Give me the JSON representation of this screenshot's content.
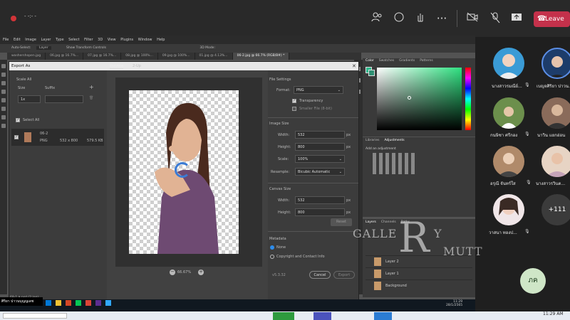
{
  "teams": {
    "meeting_timer": "- -:- -",
    "leave_label": "Leave",
    "icons": [
      "people-icon",
      "chat-icon",
      "raise-hand-icon",
      "more-icon",
      "camera-off-icon",
      "mic-off-icon",
      "share-icon",
      "phone-icon"
    ]
  },
  "photoshop": {
    "menu": [
      "File",
      "Edit",
      "Image",
      "Layer",
      "Type",
      "Select",
      "Filter",
      "3D",
      "View",
      "Plugins",
      "Window",
      "Help"
    ],
    "options": {
      "auto_select": "Auto-Select:",
      "layer": "Layer",
      "show_transform": "Show Transform Controls",
      "mode_3d": "3D Mode:"
    },
    "tabs": [
      "washershopen.jpg",
      "06.jpg @ 16.7%...",
      "07.jpg @ 16.7%...",
      "08.jpg @ 100%...",
      "09.jpg @ 100%...",
      "01.jpg @ 4.13%...",
      "06-2.jpg @ 66.7% (RGB/8#) *"
    ],
    "active_tab": 6,
    "status_file": "69-1 ล.psd (2.jpg)",
    "color_tabs": [
      "Color",
      "Swatches",
      "Gradients",
      "Patterns"
    ],
    "adj_tabs": [
      "Libraries",
      "Adjustments"
    ],
    "adj_title": "Add an adjustment",
    "layers_tabs": [
      "Layers",
      "Channels",
      "Paths"
    ],
    "layers": [
      {
        "name": "Layer 2"
      },
      {
        "name": "Layer 1"
      },
      {
        "name": "Background"
      }
    ]
  },
  "dialog": {
    "title": "Export As",
    "scale_all": "Scale All",
    "size_label": "Size",
    "suffix_label": "Suffix",
    "size_value": "1x",
    "select_all": "Select All",
    "asset": {
      "name": "06-2",
      "format": "PNG",
      "dims": "532 x 800",
      "filesize": "579.5 KB"
    },
    "preview_tab": "Preview",
    "twoup_tab": "2-Up",
    "zoom": "66.67%",
    "file_settings": "File Settings",
    "format_label": "Format:",
    "format_value": "PNG",
    "transparency": "Transparency",
    "smaller_file": "Smaller File (8-bit)",
    "image_size": "Image Size",
    "width_label": "Width:",
    "width_value": "532",
    "height_label": "Height:",
    "height_value": "800",
    "scale_label": "Scale:",
    "scale_value": "100%",
    "resample_label": "Resample:",
    "resample_value": "Bicubic Automatic",
    "px": "px",
    "canvas_size": "Canvas Size",
    "canvas_width": "532",
    "canvas_height": "800",
    "reset": "Reset",
    "metadata": "Metadata",
    "meta_none": "None",
    "meta_copyright": "Copyright and Contact Info",
    "version": "v5.3.32",
    "cancel": "Cancel",
    "export": "Export"
  },
  "participants": [
    {
      "name": "นางสาวรมณีย์...",
      "color": "#3a9bd6"
    },
    {
      "name": "เบญจศิริยา ปาวน...",
      "color": "#1d3c6a"
    },
    {
      "name": "กนษิชา ศรีกอง",
      "color": "#6c8f4c"
    },
    {
      "name": "นาวิน แยกอ่อน",
      "color": "#8a6b5a"
    },
    {
      "name": "อรุณี จันทร์ใส",
      "color": "#b08a6a"
    },
    {
      "name": "นางสาวรวินต...",
      "color": "#e7d4c4"
    },
    {
      "name": "วาสนา ทองป...",
      "color": "#f0e6e8"
    }
  ],
  "more_count": "+111",
  "my_initials": "ภค",
  "watermark": {
    "main": "GALLE",
    "letter": "R",
    "tail": "Y",
    "sub": "MUTT"
  },
  "taskbar": {
    "time_ps": "11:29",
    "date_ps": "28/1/2565",
    "time": "11:29 AM",
    "user_label": "ศิริยา ปาวนบุญญเดช"
  }
}
